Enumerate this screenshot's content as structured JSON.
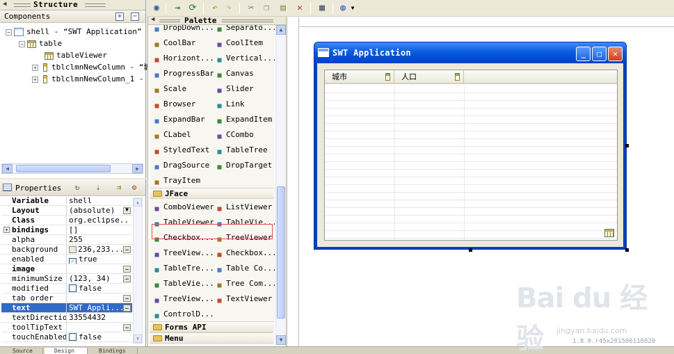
{
  "structure": {
    "title": "Structure",
    "components_label": "Components",
    "tree": [
      {
        "label": "shell - “SWT Application”",
        "level": 0,
        "icon": "shell-icon",
        "expander": "minus"
      },
      {
        "label": "table",
        "level": 1,
        "icon": "table-icon",
        "expander": "minus"
      },
      {
        "label": "tableViewer",
        "level": 2,
        "icon": "table-icon",
        "expander": ""
      },
      {
        "label": "tblclmnNewColumn - “城",
        "level": 2,
        "icon": "column-icon",
        "expander": "plus"
      },
      {
        "label": "tblclmnNewColumn_1 - “",
        "level": 2,
        "icon": "column-icon",
        "expander": "plus"
      }
    ]
  },
  "properties": {
    "title": "Properties",
    "rows": [
      {
        "key": "Variable",
        "value": "shell",
        "bold": true
      },
      {
        "key": "Layout",
        "value": "(absolute)",
        "bold": true
      },
      {
        "key": "Class",
        "value": "org.eclipse...",
        "bold": true
      },
      {
        "key": "bindings",
        "value": "[]",
        "bold": true
      },
      {
        "key": "alpha",
        "value": "255"
      },
      {
        "key": "background",
        "value": "236,233..."
      },
      {
        "key": "enabled",
        "value": "true"
      },
      {
        "key": "image",
        "value": "",
        "bold": true
      },
      {
        "key": "minimumSize",
        "value": "(123, 34)"
      },
      {
        "key": "modified",
        "value": "false"
      },
      {
        "key": "tab order",
        "value": ""
      },
      {
        "key": "text",
        "value": "SWT Appli...",
        "bold": true,
        "selected": true
      },
      {
        "key": "textDirection",
        "value": "33554432"
      },
      {
        "key": "toolTipText",
        "value": ""
      },
      {
        "key": "touchEnabled",
        "value": "false"
      }
    ]
  },
  "palette": {
    "title": "Palette",
    "items": [
      {
        "label": "DropDown...",
        "icon": "dropdown-icon"
      },
      {
        "label": "Separato...",
        "icon": "separator-icon"
      },
      {
        "label": "CoolBar",
        "icon": "coolbar-icon"
      },
      {
        "label": "CoolItem",
        "icon": "coolitem-icon"
      },
      {
        "label": "Horizont...",
        "icon": "horizontal-separator-icon"
      },
      {
        "label": "Vertical...",
        "icon": "vertical-separator-icon"
      },
      {
        "label": "ProgressBar",
        "icon": "progressbar-icon"
      },
      {
        "label": "Canvas",
        "icon": "canvas-icon"
      },
      {
        "label": "Scale",
        "icon": "scale-icon"
      },
      {
        "label": "Slider",
        "icon": "slider-icon"
      },
      {
        "label": "Browser",
        "icon": "browser-icon"
      },
      {
        "label": "Link",
        "icon": "link-icon"
      },
      {
        "label": "ExpandBar",
        "icon": "expandbar-icon"
      },
      {
        "label": "ExpandItem",
        "icon": "expanditem-icon"
      },
      {
        "label": "CLabel",
        "icon": "clabel-icon"
      },
      {
        "label": "CCombo",
        "icon": "ccombo-icon"
      },
      {
        "label": "StyledText",
        "icon": "styledtext-icon"
      },
      {
        "label": "TableTree",
        "icon": "tabletree-icon"
      },
      {
        "label": "DragSource",
        "icon": "dragsource-icon"
      },
      {
        "label": "DropTarget",
        "icon": "droptarget-icon"
      },
      {
        "label": "TrayItem",
        "icon": "trayitem-icon"
      }
    ],
    "jface_category": "JFace",
    "jface_items": [
      {
        "label": "ComboViewer",
        "icon": "comboviewer-icon"
      },
      {
        "label": "ListViewer",
        "icon": "listviewer-icon"
      },
      {
        "label": "TableViewer",
        "icon": "tableviewer-icon"
      },
      {
        "label": "TableVie...",
        "icon": "tableviewer-column-icon"
      },
      {
        "label": "Checkbox...",
        "icon": "checkbox-viewer-icon"
      },
      {
        "label": "TreeViewer",
        "icon": "treeviewer-icon"
      },
      {
        "label": "TreeView...",
        "icon": "treeviewer-column-icon"
      },
      {
        "label": "Checkbox...",
        "icon": "checkbox-tree-icon"
      },
      {
        "label": "TableTre...",
        "icon": "tabletreeviewer-icon"
      },
      {
        "label": "Table Co...",
        "icon": "table-composite-icon"
      },
      {
        "label": "TableVie...",
        "icon": "tableviewer-composite-icon"
      },
      {
        "label": "Tree Com...",
        "icon": "tree-composite-icon"
      },
      {
        "label": "TreeView...",
        "icon": "treeviewer-composite-icon"
      },
      {
        "label": "TextViewer",
        "icon": "textviewer-icon"
      },
      {
        "label": "ControlD...",
        "icon": "controldecoration-icon"
      }
    ],
    "forms_category": "Forms API",
    "menu_category": "Menu"
  },
  "swt_window": {
    "title": "SWT Application",
    "columns": [
      "城市",
      "人口"
    ]
  },
  "bottom_tabs": [
    "Source",
    "Design",
    "Bindings"
  ],
  "watermark": {
    "logo": "Bai du 经验",
    "url": "jingyan.baidu.com",
    "version": "1.8.0.r45x201506110820"
  },
  "colors": {
    "selection": "#316ac5",
    "titlebar": "#0a5be0",
    "highlight_border": "#e05050"
  }
}
